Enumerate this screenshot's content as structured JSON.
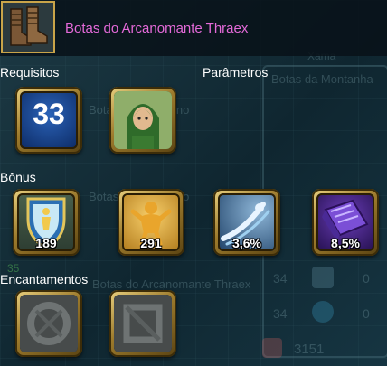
{
  "item": {
    "title": "Botas do Arcanomante Thraex",
    "icon": "leather-boots-icon"
  },
  "sections": {
    "requirements_label": "Requisitos",
    "parameters_label": "Parâmetros",
    "bonus_label": "Bônus",
    "enchantments_label": "Encantamentos"
  },
  "requirements": {
    "level": "33",
    "class_icon": "green-hooded-ranger-portrait"
  },
  "bonuses": [
    {
      "icon": "shield-defense-icon",
      "value": "189"
    },
    {
      "icon": "golden-figure-stamina-icon",
      "value": "291"
    },
    {
      "icon": "dodge-swoosh-icon",
      "value": "3,6%"
    },
    {
      "icon": "purple-spellbook-icon",
      "value": "8,5%"
    }
  ],
  "enchantments": [
    {
      "icon": "empty-rune-slot-round-icon"
    },
    {
      "icon": "empty-rune-slot-square-icon"
    }
  ],
  "background": {
    "name_label": "Xama",
    "item_line1": "Botas da Montanha",
    "item_line2": "Botas do Peregrino",
    "item_line3": "Botas do Peregrino",
    "item_line4": "Botas do Arcanomante Thraex",
    "stat_a": "33",
    "stat_b": "35",
    "stat_c": "34",
    "stat_d": "34",
    "stat_e": "0",
    "stat_f": "0",
    "gold": "3151"
  }
}
